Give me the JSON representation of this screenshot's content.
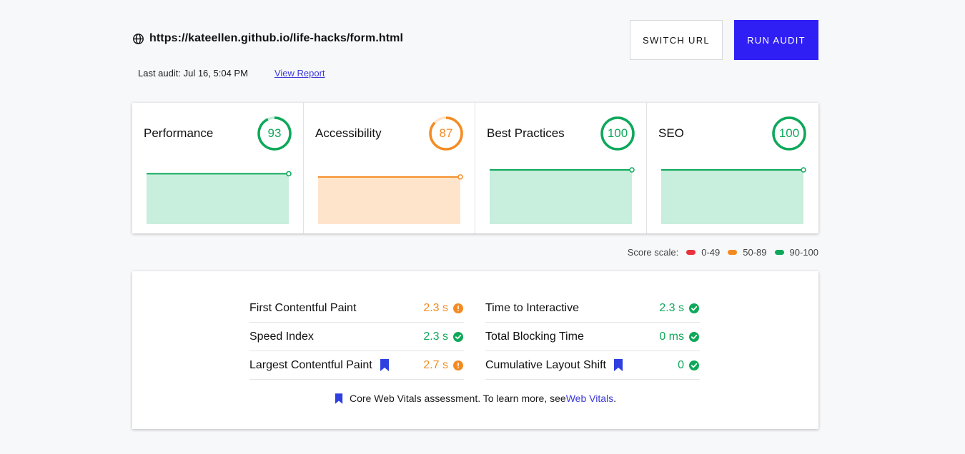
{
  "header": {
    "url": "https://kateellen.github.io/life-hacks/form.html",
    "last_audit": "Last audit: Jul 16, 5:04 PM",
    "view_report": "View Report",
    "switch_url": "SWITCH URL",
    "run_audit": "RUN AUDIT",
    "icon": "globe-icon"
  },
  "scores": [
    {
      "label": "Performance",
      "score": "93",
      "value": 93,
      "color": "#0ea85a",
      "fill": "#c8eedd"
    },
    {
      "label": "Accessibility",
      "score": "87",
      "value": 87,
      "color": "#f48b22",
      "fill": "#ffe4cc"
    },
    {
      "label": "Best Practices",
      "score": "100",
      "value": 100,
      "color": "#0ea85a",
      "fill": "#c8eedd"
    },
    {
      "label": "SEO",
      "score": "100",
      "value": 100,
      "color": "#0ea85a",
      "fill": "#c8eedd"
    }
  ],
  "scale": {
    "label": "Score scale:",
    "ranges": [
      {
        "label": "0-49",
        "color": "#e8323c"
      },
      {
        "label": "50-89",
        "color": "#f48b22"
      },
      {
        "label": "90-100",
        "color": "#0ea85a"
      }
    ]
  },
  "metrics": {
    "fcp": {
      "label": "First Contentful Paint",
      "value": "2.3 s",
      "status": "warn",
      "color": "#f48b22"
    },
    "si": {
      "label": "Speed Index",
      "value": "2.3 s",
      "status": "pass",
      "color": "#0ea85a"
    },
    "lcp": {
      "label": "Largest Contentful Paint",
      "value": "2.7 s",
      "status": "warn",
      "color": "#f48b22",
      "core_web_vital": true
    },
    "tti": {
      "label": "Time to Interactive",
      "value": "2.3 s",
      "status": "pass",
      "color": "#0ea85a"
    },
    "tbt": {
      "label": "Total Blocking Time",
      "value": "0 ms",
      "status": "pass",
      "color": "#0ea85a"
    },
    "cls": {
      "label": "Cumulative Layout Shift",
      "value": "0",
      "status": "pass",
      "color": "#0ea85a",
      "core_web_vital": true
    }
  },
  "footer": {
    "text": "Core Web Vitals assessment. To learn more, see ",
    "link": "Web Vitals",
    "period": "."
  }
}
